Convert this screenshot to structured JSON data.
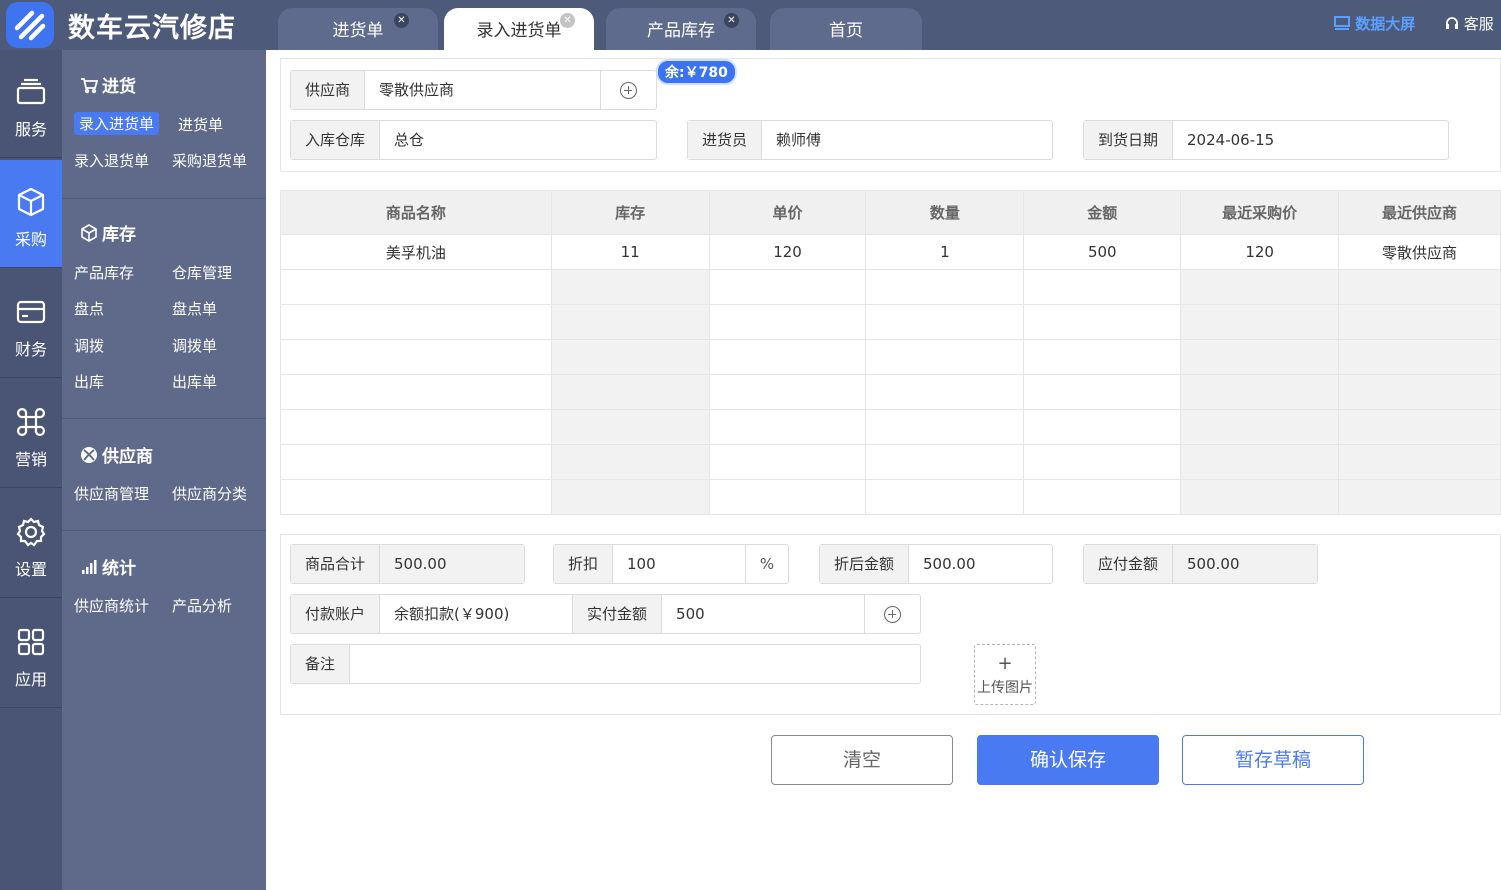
{
  "app": {
    "title": "数车云汽修店",
    "data_screen": "数据大屏",
    "service": "客服"
  },
  "tabs": [
    {
      "label": "进货单",
      "closable": true,
      "active": false
    },
    {
      "label": "录入进货单",
      "closable": true,
      "active": true
    },
    {
      "label": "产品库存",
      "closable": true,
      "active": false
    },
    {
      "label": "首页",
      "closable": false,
      "active": false
    }
  ],
  "iconbar": [
    {
      "label": "服务",
      "icon": "tray-icon"
    },
    {
      "label": "采购",
      "icon": "cube-icon",
      "active": true
    },
    {
      "label": "财务",
      "icon": "card-icon"
    },
    {
      "label": "营销",
      "icon": "command-icon"
    },
    {
      "label": "设置",
      "icon": "gear-icon"
    },
    {
      "label": "应用",
      "icon": "grid-icon"
    }
  ],
  "submenu": {
    "purchase": {
      "title": "进货",
      "items": [
        "录入进货单",
        "进货单",
        "录入退货单",
        "采购退货单"
      ]
    },
    "inventory": {
      "title": "库存",
      "items": [
        "产品库存",
        "仓库管理",
        "盘点",
        "盘点单",
        "调拨",
        "调拨单",
        "出库",
        "出库单"
      ]
    },
    "supplier": {
      "title": "供应商",
      "items": [
        "供应商管理",
        "供应商分类"
      ]
    },
    "stats": {
      "title": "统计",
      "items": [
        "供应商统计",
        "产品分析"
      ]
    }
  },
  "form": {
    "supplier_label": "供应商",
    "supplier_value": "零散供应商",
    "balance_badge": "余:￥780",
    "warehouse_label": "入库仓库",
    "warehouse_value": "总仓",
    "buyer_label": "进货员",
    "buyer_value": "赖师傅",
    "arrival_label": "到货日期",
    "arrival_value": "2024-06-15"
  },
  "table": {
    "headers": [
      "商品名称",
      "库存",
      "单价",
      "数量",
      "金额",
      "最近采购价",
      "最近供应商"
    ],
    "rows": [
      [
        "美孚机油",
        "11",
        "120",
        "1",
        "500",
        "120",
        "零散供应商"
      ]
    ]
  },
  "summary": {
    "goods_total_label": "商品合计",
    "goods_total_value": "500.00",
    "discount_label": "折扣",
    "discount_value": "100",
    "discount_unit": "%",
    "after_discount_label": "折后金额",
    "after_discount_value": "500.00",
    "payable_label": "应付金额",
    "payable_value": "500.00",
    "pay_account_label": "付款账户",
    "pay_account_value": "余额扣款(￥900)",
    "paid_label": "实付金额",
    "paid_value": "500",
    "remark_label": "备注",
    "remark_value": "",
    "upload_label": "上传图片"
  },
  "buttons": {
    "clear": "清空",
    "save": "确认保存",
    "draft": "暂存草稿"
  }
}
